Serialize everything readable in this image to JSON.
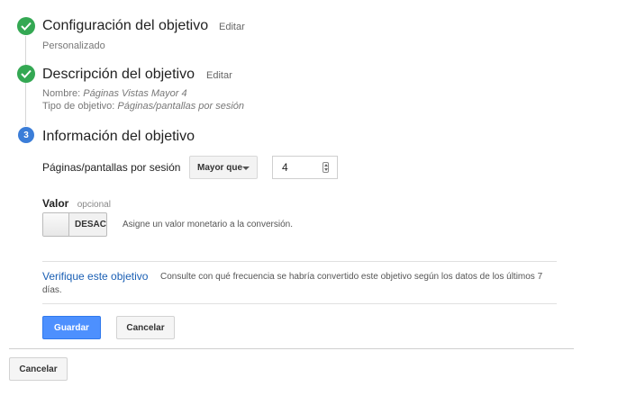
{
  "steps": [
    {
      "title": "Configuración del objetivo",
      "edit_label": "Editar",
      "summary": "Personalizado"
    },
    {
      "title": "Descripción del objetivo",
      "edit_label": "Editar",
      "name_label": "Nombre:",
      "name_value": "Páginas Vistas Mayor 4",
      "type_label": "Tipo de objetivo:",
      "type_value": "Páginas/pantallas por sesión"
    },
    {
      "number": "3",
      "title": "Información del objetivo"
    }
  ],
  "condition": {
    "label": "Páginas/pantallas por sesión",
    "operator": "Mayor que",
    "value": "4"
  },
  "valor": {
    "label": "Valor",
    "optional": "opcional",
    "toggle_state": "DESACT",
    "hint": "Asigne un valor monetario a la conversión."
  },
  "verify": {
    "link": "Verifique este objetivo",
    "description_line1": "Consulte con qué frecuencia se habría convertido este objetivo según los datos de los últimos 7",
    "description_line2": "días."
  },
  "actions": {
    "save": "Guardar",
    "cancel": "Cancelar"
  },
  "footer": {
    "cancel": "Cancelar"
  },
  "colors": {
    "check_green": "#34a853",
    "step_blue": "#3b7dd8",
    "link_blue": "#1a5fb4",
    "primary_button": "#4d90fe"
  }
}
